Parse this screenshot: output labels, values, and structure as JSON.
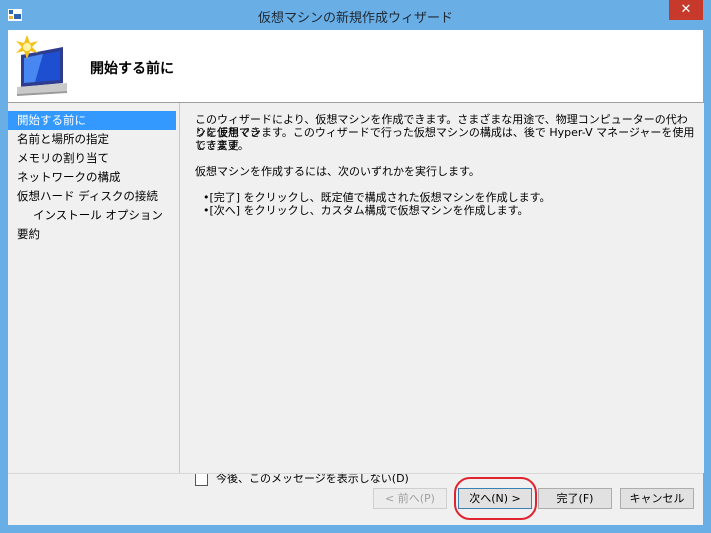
{
  "window": {
    "title": "仮想マシンの新規作成ウィザード",
    "close_label": "✕"
  },
  "header": {
    "title": "開始する前に"
  },
  "nav": {
    "items": [
      {
        "label": "開始する前に"
      },
      {
        "label": "名前と場所の指定"
      },
      {
        "label": "メモリの割り当て"
      },
      {
        "label": "ネットワークの構成"
      },
      {
        "label": "仮想ハード ディスクの接続"
      },
      {
        "label": "インストール オプション"
      },
      {
        "label": "要約"
      }
    ],
    "active_index": 0
  },
  "content": {
    "intro_line1": "このウィザードにより、仮想マシンを作成できます。さまざまな用途で、物理コンピューターの代わりに仮想マシ",
    "intro_line2": "ンを使用できます。このウィザードで行った仮想マシンの構成は、後で Hyper-V マネージャーを使用して変更",
    "intro_line3": "できます。",
    "choose": "仮想マシンを作成するには、次のいずれかを実行します。",
    "bullet1": "•[完了] をクリックし、既定値で構成された仮想マシンを作成します。",
    "bullet2": "•[次へ] をクリックし、カスタム構成で仮想マシンを作成します。",
    "dont_show_label": "今後、このメッセージを表示しない(D)",
    "dont_show_checked": false
  },
  "buttons": {
    "back": "< 前へ(P)",
    "next": "次へ(N) >",
    "finish": "完了(F)",
    "cancel": "キャンセル"
  },
  "colors": {
    "titlebar": "#6aaee6",
    "selection": "#3399ff",
    "close": "#c7392b",
    "annotation": "#e0242f"
  }
}
